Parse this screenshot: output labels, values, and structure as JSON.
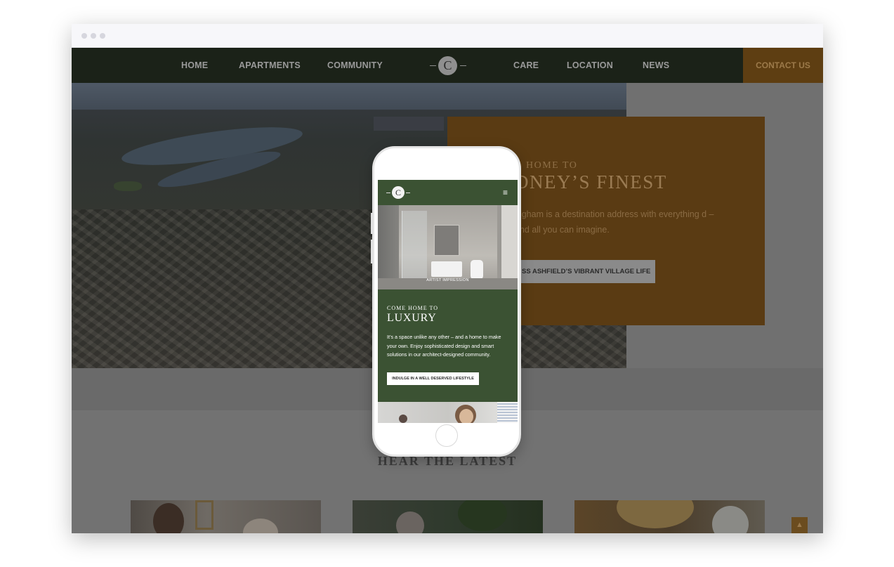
{
  "desktop": {
    "nav": {
      "items": [
        "HOME",
        "APARTMENTS",
        "COMMUNITY",
        "CARE",
        "LOCATION",
        "NEWS"
      ],
      "logo_letter": "C",
      "contact_label": "CONTACT US"
    },
    "hero": {
      "eyebrow": "HOME TO",
      "headline": "DNEY’S FINEST",
      "body": "ingham is a destination address with everything d – and all you can imagine.",
      "cta": "SS ASHFIELD’S VIBRANT VILLAGE LIFE"
    },
    "latest": {
      "title": "HEAR THE LATEST"
    },
    "scroll_top_icon": "▲"
  },
  "mobile": {
    "nav": {
      "logo_letter": "C",
      "menu_icon": "≡"
    },
    "photo_caption": "ARTIST IMPRESSION",
    "hero": {
      "eyebrow": "COME HOME TO",
      "title": "LUXURY",
      "body": "It’s a space unlike any other – and a home to make your own. Enjoy sophisticated design and smart solutions in our architect-designed community.",
      "cta": "INDULGE IN A WELL DESERVED LIFESTYLE"
    }
  },
  "colors": {
    "nav_bg": "#1b2218",
    "accent_gold": "#5a3b13",
    "mobile_green": "#3b5233"
  }
}
